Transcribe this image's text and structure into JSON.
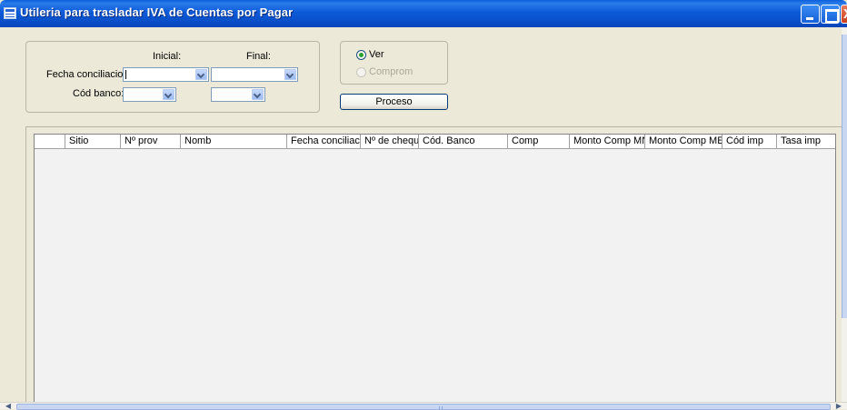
{
  "window": {
    "title": "Utileria para trasladar IVA de Cuentas por Pagar",
    "close_glyph": "X"
  },
  "filters": {
    "inicial_label": "Inicial:",
    "final_label": "Final:",
    "fecha_label": "Fecha conciliacion:",
    "banco_label": "Cód banco:",
    "fecha_inicial_value": "",
    "fecha_final_value": "",
    "banco_inicial_value": "",
    "banco_final_value": ""
  },
  "options": {
    "ver_label": "Ver",
    "comprom_label": "Comprom",
    "selected": "Ver"
  },
  "actions": {
    "process_label": "Proceso"
  },
  "grid": {
    "columns": [
      "",
      "Sitio",
      "Nº prov",
      "Nomb",
      "Fecha conciliacion",
      "Nº de cheque",
      "Cód. Banco",
      "Comp",
      "Monto Comp MN",
      "Monto Comp ME",
      "Cód imp",
      "Tasa imp"
    ],
    "rows": []
  },
  "colors": {
    "titlebar": "#0A4FC8",
    "window_bg": "#ECE9D8",
    "grid_bg": "#F2F2F2",
    "radio_checked": "#2DA12D"
  }
}
